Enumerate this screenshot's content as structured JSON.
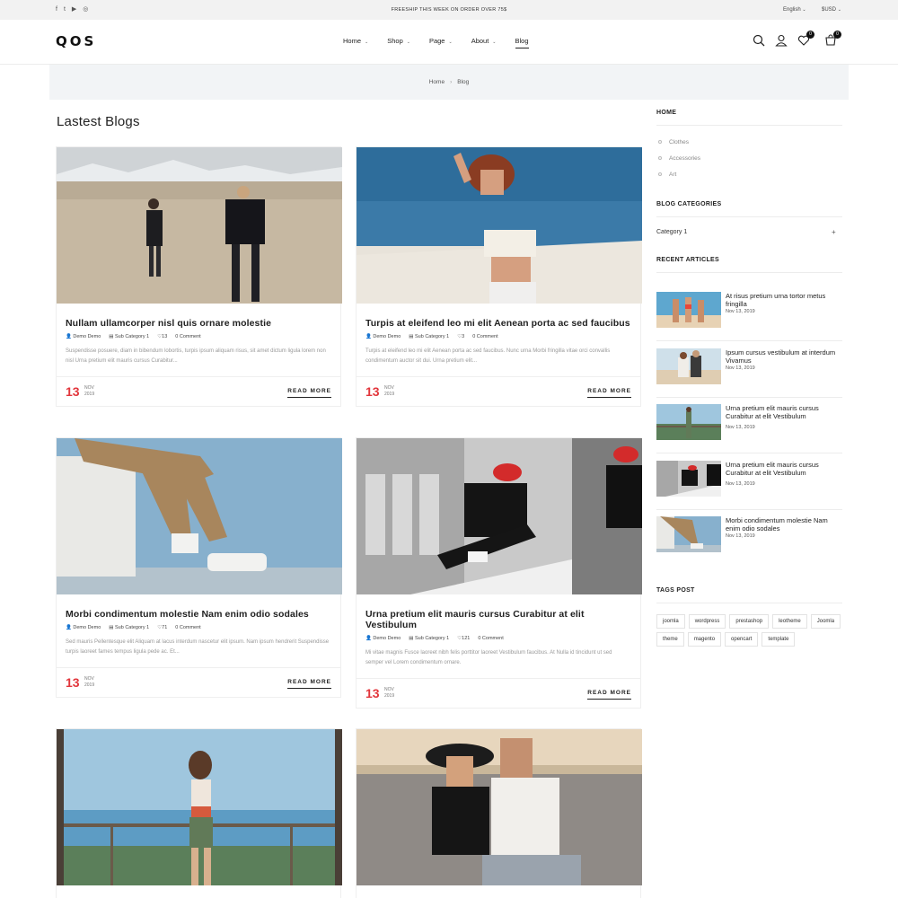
{
  "topbar": {
    "socials": [
      "f",
      "t",
      "▶",
      "◎"
    ],
    "promo": "FREESHIP THIS WEEK ON ORDER OVER 75$",
    "language": "English",
    "currency": "$USD"
  },
  "header": {
    "logo": "QOS",
    "nav": [
      {
        "label": "Home",
        "chevron": true
      },
      {
        "label": "Shop",
        "chevron": true
      },
      {
        "label": "Page",
        "chevron": true
      },
      {
        "label": "About",
        "chevron": true
      },
      {
        "label": "Blog",
        "chevron": false
      }
    ],
    "wishlist_count": "0",
    "cart_count": "0",
    "chevron_glyph": "⌄"
  },
  "breadcrumb": {
    "home": "Home",
    "sep": "›",
    "current": "Blog"
  },
  "page_title": "Lastest Blogs",
  "posts": [
    {
      "title": "Nullam ullamcorper nisl quis ornare molestie",
      "author": "Demo Demo",
      "category": "Sub Category 1",
      "likes": "13",
      "comments": "0 Comment",
      "excerpt": "Suspendisse posuere, diam in bibendum lobortis, turpis ipsum aliquam risus, sit amet dictum ligula lorem non nisl Urna pretium elit mauris cursus Curabitur...",
      "day": "13",
      "month": "NOV",
      "year": "2019",
      "more": "READ MORE"
    },
    {
      "title": "Turpis at eleifend leo mi elit Aenean porta ac sed faucibus",
      "author": "Demo Demo",
      "category": "Sub Category 1",
      "likes": "3",
      "comments": "0 Comment",
      "excerpt": "Turpis at eleifend leo mi elit Aenean porta ac sed faucibus. Nunc urna Morbi fringilla vitae orci convallis condimentum auctor sit dui. Urna pretium elit...",
      "day": "13",
      "month": "NOV",
      "year": "2019",
      "more": "READ MORE"
    },
    {
      "title": "Morbi condimentum molestie Nam enim odio sodales",
      "author": "Demo Demo",
      "category": "Sub Category 1",
      "likes": "71",
      "comments": "0 Comment",
      "excerpt": "Sed mauris Pellentesque elit Aliquam at lacus interdum nascetur elit ipsum. Nam ipsum hendrerit Suspendisse turpis laoreet fames tempus ligula pede ac. Et...",
      "day": "13",
      "month": "NOV",
      "year": "2019",
      "more": "READ MORE"
    },
    {
      "title": "Urna pretium elit mauris cursus Curabitur at elit Vestibulum",
      "author": "Demo Demo",
      "category": "Sub Category 1",
      "likes": "121",
      "comments": "0 Comment",
      "excerpt": "Mi vitae magnis Fusce laoreet nibh felis porttitor laoreet Vestibulum faucibus. At Nulla id tincidunt ut sed semper vel Lorem condimentum ornare.",
      "day": "13",
      "month": "NOV",
      "year": "2019",
      "more": "READ MORE"
    }
  ],
  "sidebar": {
    "home_heading": "HOME",
    "home_items": [
      "Clothes",
      "Accessories",
      "Art"
    ],
    "categories_heading": "BLOG CATEGORIES",
    "category_item": "Category 1",
    "category_toggle": "+",
    "recent_heading": "RECENT ARTICLES",
    "recent": [
      {
        "title": "At risus pretium urna tortor metus fringilla",
        "date": "Nov 13, 2019"
      },
      {
        "title": "Ipsum cursus vestibulum at interdum Vivamus",
        "date": "Nov 13, 2019"
      },
      {
        "title": "Urna pretium elit mauris cursus Curabitur at elit Vestibulum",
        "date": "Nov 13, 2019"
      },
      {
        "title": "Urna pretium elit mauris cursus Curabitur at elit Vestibulum",
        "date": "Nov 13, 2019"
      },
      {
        "title": "Morbi condimentum molestie Nam enim odio sodales",
        "date": "Nov 13, 2019"
      }
    ],
    "tags_heading": "TAGS POST",
    "tags": [
      "joomla",
      "wordpress",
      "prestashop",
      "leotheme",
      "Joomla",
      "theme",
      "magento",
      "opencart",
      "template"
    ]
  }
}
